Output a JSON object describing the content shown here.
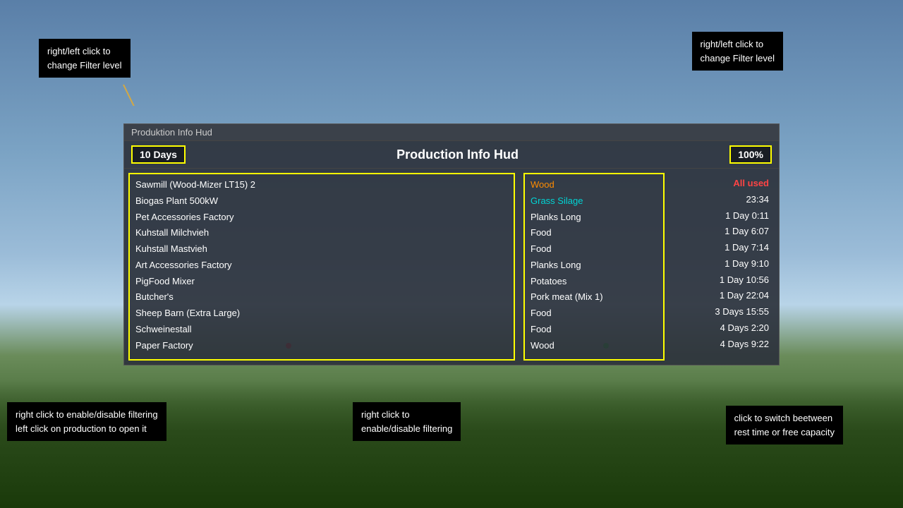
{
  "background": {
    "description": "Sky and landscape background"
  },
  "tooltips": {
    "top_left": {
      "text": "right/left click to\nchange Filter level"
    },
    "top_right": {
      "text": "right/left click to\nchange Filter level"
    },
    "bottom_left": {
      "line1": "right click to enable/disable filtering",
      "line2": "left click on production to open it"
    },
    "bottom_center": {
      "line1": "right click to",
      "line2": "enable/disable filtering"
    },
    "bottom_right": {
      "line1": "click to switch beetween",
      "line2": "rest time or free capacity"
    }
  },
  "hud": {
    "title_bar": "Produktion Info Hud",
    "main_title": "Production Info Hud",
    "filter_days": "10 Days",
    "filter_percent": "100%",
    "productions": [
      "Sawmill (Wood-Mizer LT15) 2",
      "Biogas Plant 500kW",
      "Pet Accessories Factory",
      "Kuhstall Milchvieh",
      "Kuhstall Mastvieh",
      "Art Accessories Factory",
      "PigFood Mixer",
      "Butcher's",
      "Sheep Barn (Extra Large)",
      "Schweinestall",
      "Paper Factory"
    ],
    "outputs": [
      {
        "text": "Wood",
        "color": "orange"
      },
      {
        "text": "Grass Silage",
        "color": "teal"
      },
      {
        "text": "Planks Long",
        "color": "white"
      },
      {
        "text": "Food",
        "color": "white"
      },
      {
        "text": "Food",
        "color": "white"
      },
      {
        "text": "Planks Long",
        "color": "white"
      },
      {
        "text": "Potatoes",
        "color": "white"
      },
      {
        "text": "Pork meat (Mix 1)",
        "color": "white"
      },
      {
        "text": "Food",
        "color": "white"
      },
      {
        "text": "Food",
        "color": "white"
      },
      {
        "text": "Wood",
        "color": "white"
      }
    ],
    "times_header": "All used",
    "times": [
      "23:34",
      "1 Day 0:11",
      "1 Day 6:07",
      "1 Day 7:14",
      "1 Day 9:10",
      "1 Day 10:56",
      "1 Day 22:04",
      "3 Days 15:55",
      "4 Days 2:20",
      "4 Days 9:22"
    ]
  }
}
